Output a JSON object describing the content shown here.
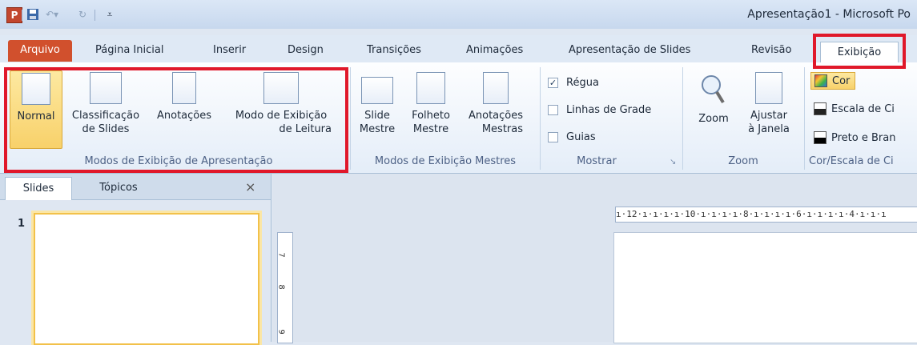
{
  "window": {
    "title": "Apresentação1 - Microsoft Po"
  },
  "qat": {
    "app_icon": "P",
    "save_icon": "floppy-disk",
    "undo_icon": "undo",
    "redo_icon": "redo",
    "menu_icon": "dropdown"
  },
  "tabs": [
    {
      "label": "Arquivo"
    },
    {
      "label": "Página Inicial"
    },
    {
      "label": "Inserir"
    },
    {
      "label": "Design"
    },
    {
      "label": "Transições"
    },
    {
      "label": "Animações"
    },
    {
      "label": "Apresentação de Slides"
    },
    {
      "label": "Revisão"
    },
    {
      "label": "Exibição"
    }
  ],
  "ribbon": {
    "modos_apresentacao": {
      "label": "Modos de Exibição de Apresentação",
      "buttons": [
        {
          "line1": "Normal",
          "line2": ""
        },
        {
          "line1": "Classificação",
          "line2": "de Slides"
        },
        {
          "line1": "Anotações",
          "line2": ""
        },
        {
          "line1": "Modo de Exibição",
          "line2": "de Leitura"
        }
      ]
    },
    "modos_mestres": {
      "label": "Modos de Exibição Mestres",
      "buttons": [
        {
          "line1": "Slide",
          "line2": "Mestre"
        },
        {
          "line1": "Folheto",
          "line2": "Mestre"
        },
        {
          "line1": "Anotações",
          "line2": "Mestras"
        }
      ]
    },
    "mostrar": {
      "label": "Mostrar",
      "items": [
        {
          "label": "Régua",
          "checked": true
        },
        {
          "label": "Linhas de Grade",
          "checked": false
        },
        {
          "label": "Guias",
          "checked": false
        }
      ]
    },
    "zoom": {
      "label": "Zoom",
      "buttons": [
        {
          "line1": "Zoom",
          "line2": ""
        },
        {
          "line1": "Ajustar",
          "line2": "à Janela"
        }
      ]
    },
    "cor": {
      "label": "Cor/Escala de Ci",
      "items": [
        {
          "label": "Cor"
        },
        {
          "label": "Escala de Ci"
        },
        {
          "label": "Preto e Bran"
        }
      ]
    }
  },
  "pane": {
    "tab_slides": "Slides",
    "tab_topicos": "Tópicos",
    "close": "×",
    "slide_number": "1"
  },
  "rulers": {
    "horizontal": "ı·12·ı·ı·ı·ı·10·ı·ı·ı·ı·8·ı·ı·ı·ı·6·ı·ı·ı·ı·4·ı·ı·ı",
    "vertical": [
      "7",
      "8",
      "9"
    ]
  }
}
